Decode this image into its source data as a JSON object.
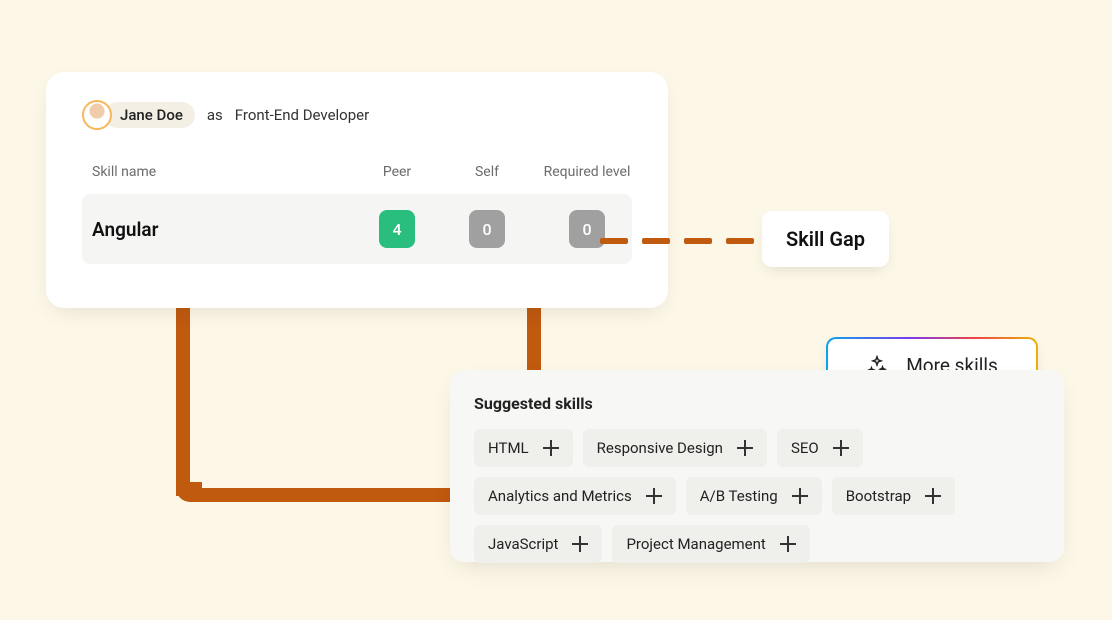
{
  "person": {
    "name": "Jane Doe",
    "role_prefix": "as",
    "role": "Front-End Developer"
  },
  "table": {
    "headers": {
      "skill": "Skill name",
      "peer": "Peer",
      "self": "Self",
      "required": "Required level"
    },
    "row": {
      "skill": "Angular",
      "peer": "4",
      "self": "0",
      "required": "0"
    }
  },
  "gap_label": "Skill Gap",
  "suggested": {
    "title": "Suggested skills",
    "skills": [
      "HTML",
      "Responsive Design",
      "SEO",
      "Analytics and Metrics",
      "A/B Testing",
      "Bootstrap",
      "JavaScript",
      "Project Management"
    ]
  },
  "more_button": "More skills"
}
